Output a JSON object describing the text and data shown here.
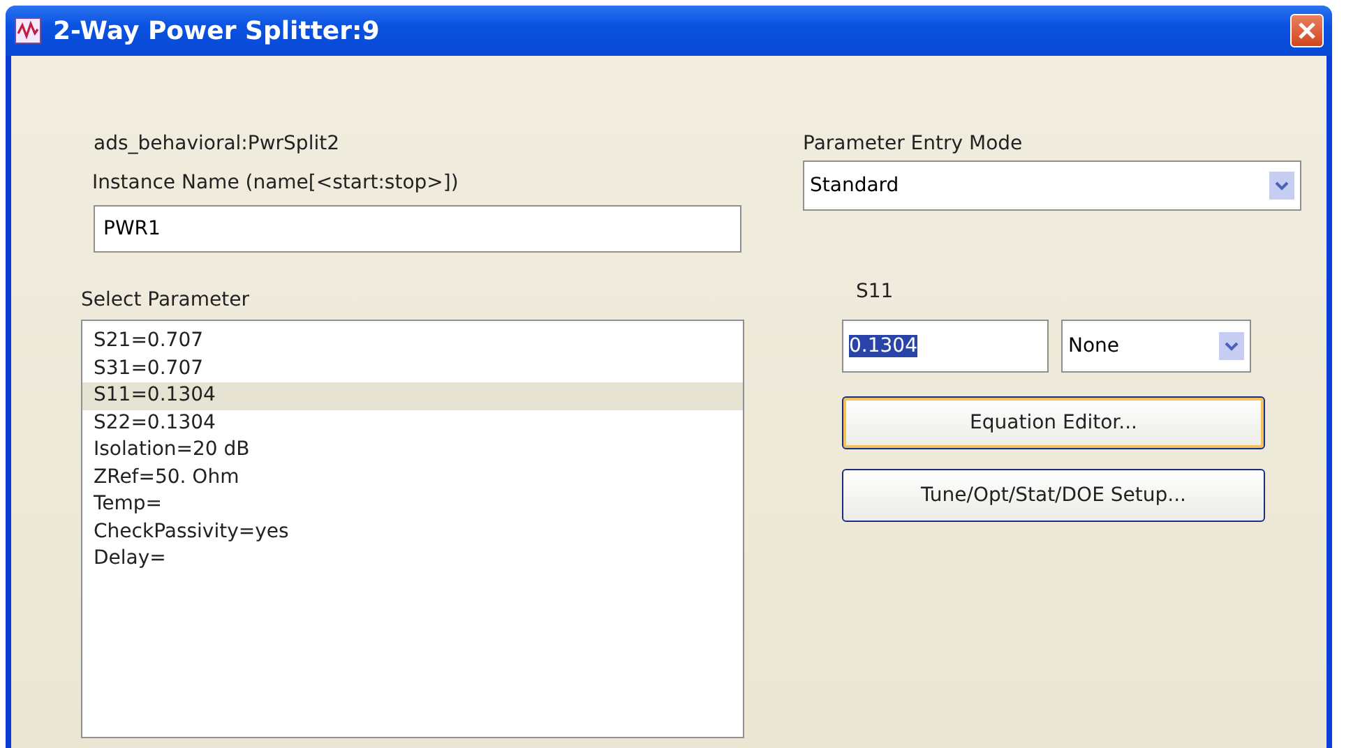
{
  "window": {
    "title": "2-Way Power Splitter:9"
  },
  "component": "ads_behavioral:PwrSplit2",
  "instance": {
    "label": "Instance Name  (name[<start:stop>])",
    "value": "PWR1"
  },
  "parameters": {
    "label": "Select Parameter",
    "items": [
      {
        "text": "S21=0.707",
        "selected": false
      },
      {
        "text": "S31=0.707",
        "selected": false
      },
      {
        "text": "S11=0.1304",
        "selected": true
      },
      {
        "text": "S22=0.1304",
        "selected": false
      },
      {
        "text": "Isolation=20 dB",
        "selected": false
      },
      {
        "text": "ZRef=50. Ohm",
        "selected": false
      },
      {
        "text": "Temp=",
        "selected": false
      },
      {
        "text": "CheckPassivity=yes",
        "selected": false
      },
      {
        "text": "Delay=",
        "selected": false
      }
    ]
  },
  "entry_mode": {
    "label": "Parameter Entry Mode",
    "value": "Standard"
  },
  "editor": {
    "label": "S11",
    "value": "0.1304",
    "value_selected": true,
    "unit": "None"
  },
  "buttons": [
    {
      "label": "Equation Editor...",
      "focused": true
    },
    {
      "label": "Tune/Opt/Stat/DOE Setup...",
      "focused": false
    }
  ]
}
